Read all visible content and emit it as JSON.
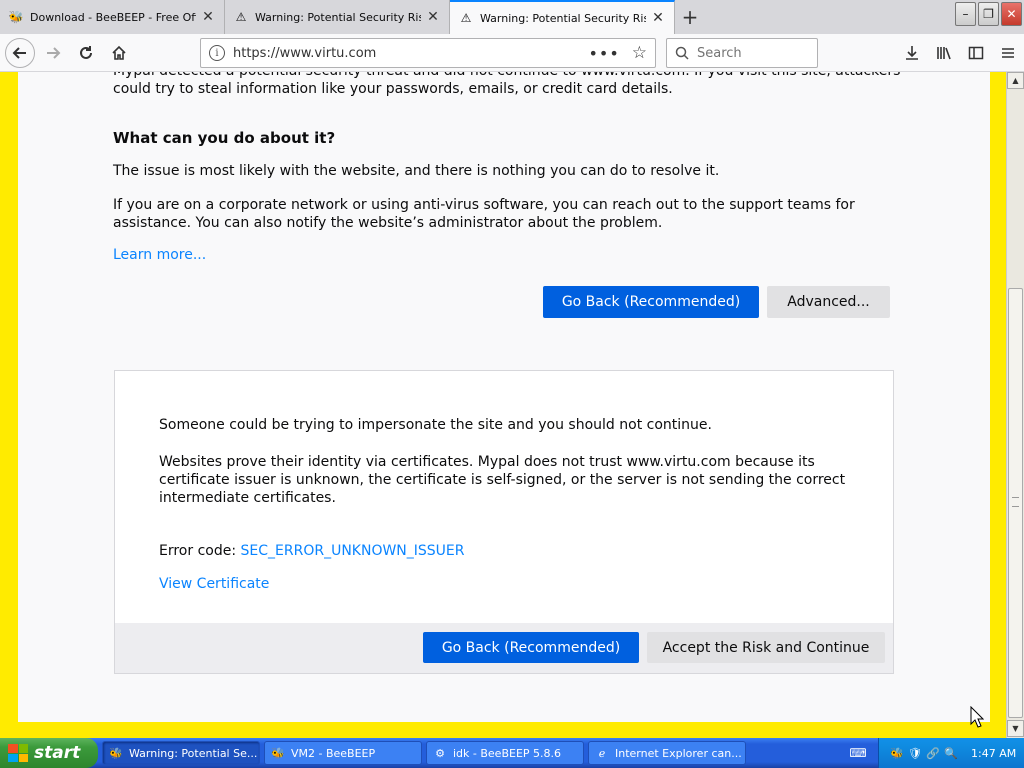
{
  "tabs": [
    {
      "label": "Download - BeeBEEP - Free Office",
      "icon": "beebeep-icon",
      "active": false
    },
    {
      "label": "Warning: Potential Security Risk A",
      "icon": "warning-icon",
      "active": false
    },
    {
      "label": "Warning: Potential Security Risk A",
      "icon": "warning-icon",
      "active": true
    }
  ],
  "window_controls": {
    "minimize": "–",
    "restore": "❐",
    "close": "✕"
  },
  "navbar": {
    "url": "https://www.virtu.com",
    "search_placeholder": "Search"
  },
  "page": {
    "cut_text": "Mypal detected a potential security threat and did not continue to www.virtu.com. If you visit this site, attackers could try to steal information like your passwords, emails, or credit card details.",
    "what_heading": "What can you do about it?",
    "p1": "The issue is most likely with the website, and there is nothing you can do to resolve it.",
    "p2": "If you are on a corporate network or using anti-virus software, you can reach out to the support teams for assistance. You can also notify the website’s administrator about the problem.",
    "learn_more": "Learn more...",
    "go_back": "Go Back (Recommended)",
    "advanced": "Advanced...",
    "advanced_box": {
      "text1": "Someone could be trying to impersonate the site and you should not continue.",
      "text2": "Websites prove their identity via certificates. Mypal does not trust www.virtu.com because its certificate issuer is unknown, the certificate is self-signed, or the server is not sending the correct intermediate certificates.",
      "error_label": "Error code: ",
      "error_code": "SEC_ERROR_UNKNOWN_ISSUER",
      "view_certificate": "View Certificate",
      "go_back": "Go Back (Recommended)",
      "accept": "Accept the Risk and Continue"
    }
  },
  "taskbar": {
    "start": "start",
    "tasks": [
      {
        "label": "Warning: Potential Se...",
        "active": true
      },
      {
        "label": "VM2 - BeeBEEP",
        "active": false
      },
      {
        "label": "idk - BeeBEEP 5.8.6",
        "active": false
      },
      {
        "label": "Internet Explorer can...",
        "active": false
      }
    ],
    "clock": "1:47 AM"
  }
}
